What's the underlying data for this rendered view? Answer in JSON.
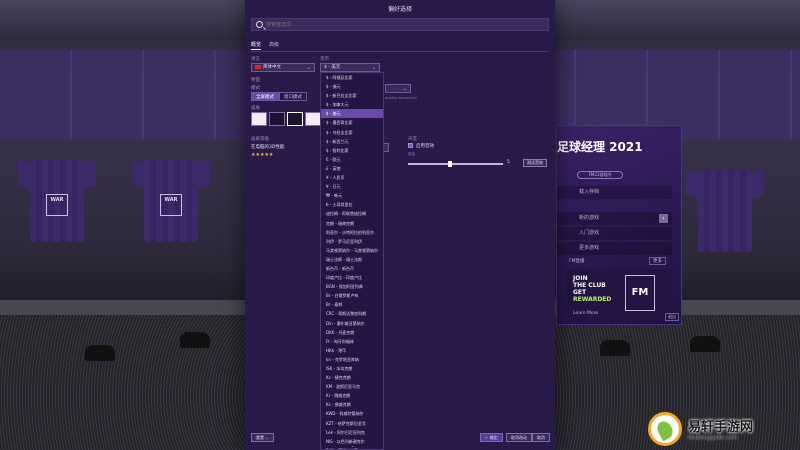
{
  "dialog": {
    "title": "偏好选择",
    "search_placeholder": "搜索首选项..."
  },
  "tabs": [
    {
      "label": "概览",
      "active": true
    },
    {
      "label": "高级",
      "active": false
    }
  ],
  "settings": {
    "language_label": "语言",
    "language_value": "简体中文",
    "currency_label": "货币",
    "currency_value": "$ - 美元",
    "interface_label": "界面",
    "mode_label": "模式",
    "mode_fullscreen": "全屏模式",
    "mode_windowed": "窗口模式",
    "skin_label": "皮肤",
    "quality_label": "画质等级",
    "quality_value": "在电脑的3D性能",
    "quality_stars": "★★★★★",
    "faint_hint": "quality interactive",
    "sound_label": "声音",
    "sound_toggle_label": "启用音效",
    "sound_slider_value": "5",
    "sound_test_button": "测试音效"
  },
  "currency_options": [
    "$ - 阿根廷比索",
    "$ - 澳元",
    "$ - 新巴拉圭比索",
    "$ - 加拿大元",
    "$ - 美元",
    "$ - 墨西哥比索",
    "$ - 乌拉圭比索",
    "$ - 新西兰元",
    "$ - 智利比索",
    "€ - 欧元",
    "£ - 英镑",
    "¥ - 人民币",
    "¥ - 日元",
    "₩ - 韩元",
    "₺ - 土耳其里拉",
    "迪拉姆 - 阿联酋迪拉姆",
    "克朗 - 瑞典克朗",
    "利亚尔 - 沙特阿拉伯利亚尔",
    "列伊 - 罗马尼亚列伊",
    "马其顿第纳尔 - 马其顿第纳尔",
    "瑞士法郎 - 瑞士法郎",
    "新台币 - 新台币",
    "印度卢比 - 印度卢比",
    "BGN - 保加利亚列弗",
    "Br - 白俄罗斯卢布",
    "Br - 泰铢",
    "CRC - 哥斯达黎加科朗",
    "Din - 塞尔维亚第纳尔",
    "DKK - 丹麦克朗",
    "Ft - 匈牙利福林",
    "HK$ - 港币",
    "kn - 克罗地亚库纳",
    "ISK - 冰岛克朗",
    "Kc - 捷克克朗",
    "KM - 波斯尼亚马克",
    "Kr - 挪威克朗",
    "Ks - 挪威克朗",
    "KWD - 科威特第纳尔",
    "KZT - 哈萨克斯坦坚戈",
    "Lek - 阿尔巴尼亚列克",
    "NIS - 以色列新谢克尔",
    "PHP - 菲律宾比索",
    "QAR - 卡塔尔里亚尔"
  ],
  "currency_selected_index": 4,
  "dropdown_more": "⌄",
  "footer": {
    "left_button": "重置",
    "confirm_button": "确定",
    "cancel_changes_button": "取消改动",
    "cancel_button": "取消"
  },
  "fm_panel": {
    "title": "足球经理 2021",
    "edition_badge": "FM21游戏内",
    "load_game": "载入存档",
    "new_game": "新的游戏",
    "tutorial": "入门游戏",
    "more_games": "更多游戏",
    "fm_stream": "FM直播",
    "more_button": "更多",
    "promo_line1": "JOIN",
    "promo_line2": "THE CLUB",
    "promo_line3": "GET",
    "promo_line4": "REWARDED",
    "promo_link": "Learn More",
    "promo_logo": "FM",
    "exit_button": "退出"
  },
  "watermark": {
    "name": "易轩手游网",
    "url": "ibudongguan.com"
  },
  "shirt_badge": "WAR",
  "colors": {
    "dialog_bg": "#2a1a4a",
    "accent": "#6a4aa8",
    "stars": "#f0c040"
  }
}
